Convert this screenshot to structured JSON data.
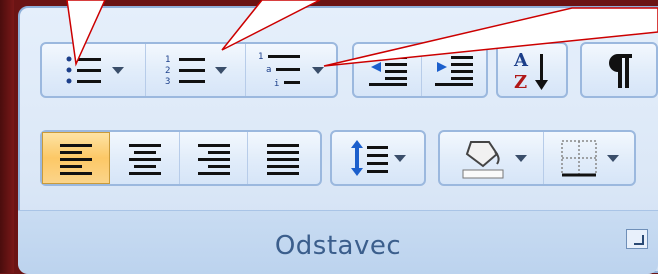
{
  "group": {
    "label": "Odstavec"
  },
  "icons": {
    "bullets": "bulleted-list-icon",
    "numbering": "numbered-list-icon",
    "multilevel": "multilevel-list-icon",
    "decrease_indent": "decrease-indent-icon",
    "increase_indent": "increase-indent-icon",
    "sort": "sort-icon",
    "show_marks": "pilcrow-icon",
    "align_left": "align-left-icon",
    "align_center": "align-center-icon",
    "align_right": "align-right-icon",
    "justify": "justify-icon",
    "line_spacing": "line-spacing-icon",
    "shading": "shading-bucket-icon",
    "borders": "borders-icon",
    "launcher": "dialog-launcher-icon"
  },
  "colors": {
    "background": "#6b1414",
    "group_bg": "#dce8f7",
    "active_button": "#fcc866",
    "callout_line": "#cc0000",
    "label": "#3b5e8c"
  }
}
